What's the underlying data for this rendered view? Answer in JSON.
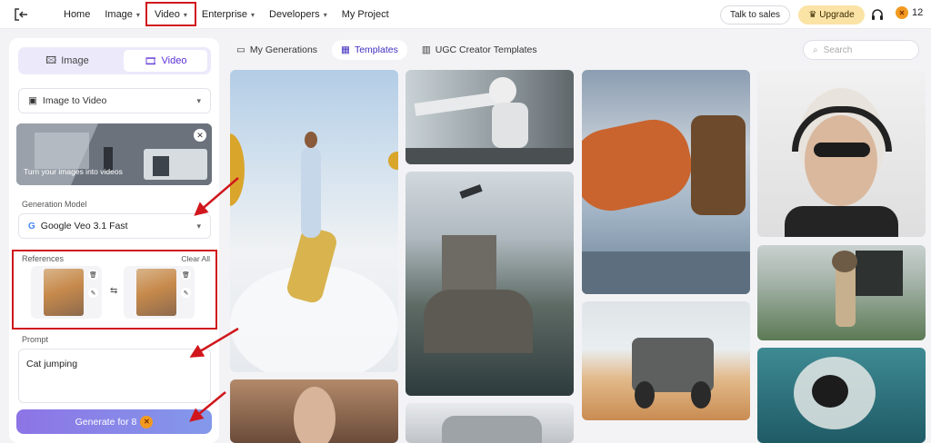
{
  "nav": {
    "items": [
      {
        "label": "Home",
        "has_dropdown": false
      },
      {
        "label": "Image",
        "has_dropdown": true
      },
      {
        "label": "Video",
        "has_dropdown": true,
        "highlighted": true
      },
      {
        "label": "Enterprise",
        "has_dropdown": true
      },
      {
        "label": "Developers",
        "has_dropdown": true
      },
      {
        "label": "My Project",
        "has_dropdown": false
      }
    ],
    "talk_to_sales": "Talk to sales",
    "upgrade": "Upgrade",
    "credits": "12"
  },
  "left_panel": {
    "toggle": {
      "image_label": "Image",
      "video_label": "Video",
      "active": "Video"
    },
    "mode_select": "Image to Video",
    "banner_text": "Turn your images into videos",
    "model_label": "Generation Model",
    "model_value": "Google Veo 3.1 Fast",
    "references_label": "References",
    "clear_all": "Clear All",
    "prompt_label": "Prompt",
    "prompt_value": "Cat jumping",
    "generate_label": "Generate for 8"
  },
  "tabs": [
    {
      "label": "My Generations",
      "active": false
    },
    {
      "label": "Templates",
      "active": true
    },
    {
      "label": "UGC Creator Templates",
      "active": false
    }
  ],
  "search_placeholder": "Search",
  "colors": {
    "accent": "#5a2fd6",
    "highlight_red": "#d0161c",
    "upgrade_bg": "#fbe3a6",
    "coin": "#f29a1f"
  }
}
